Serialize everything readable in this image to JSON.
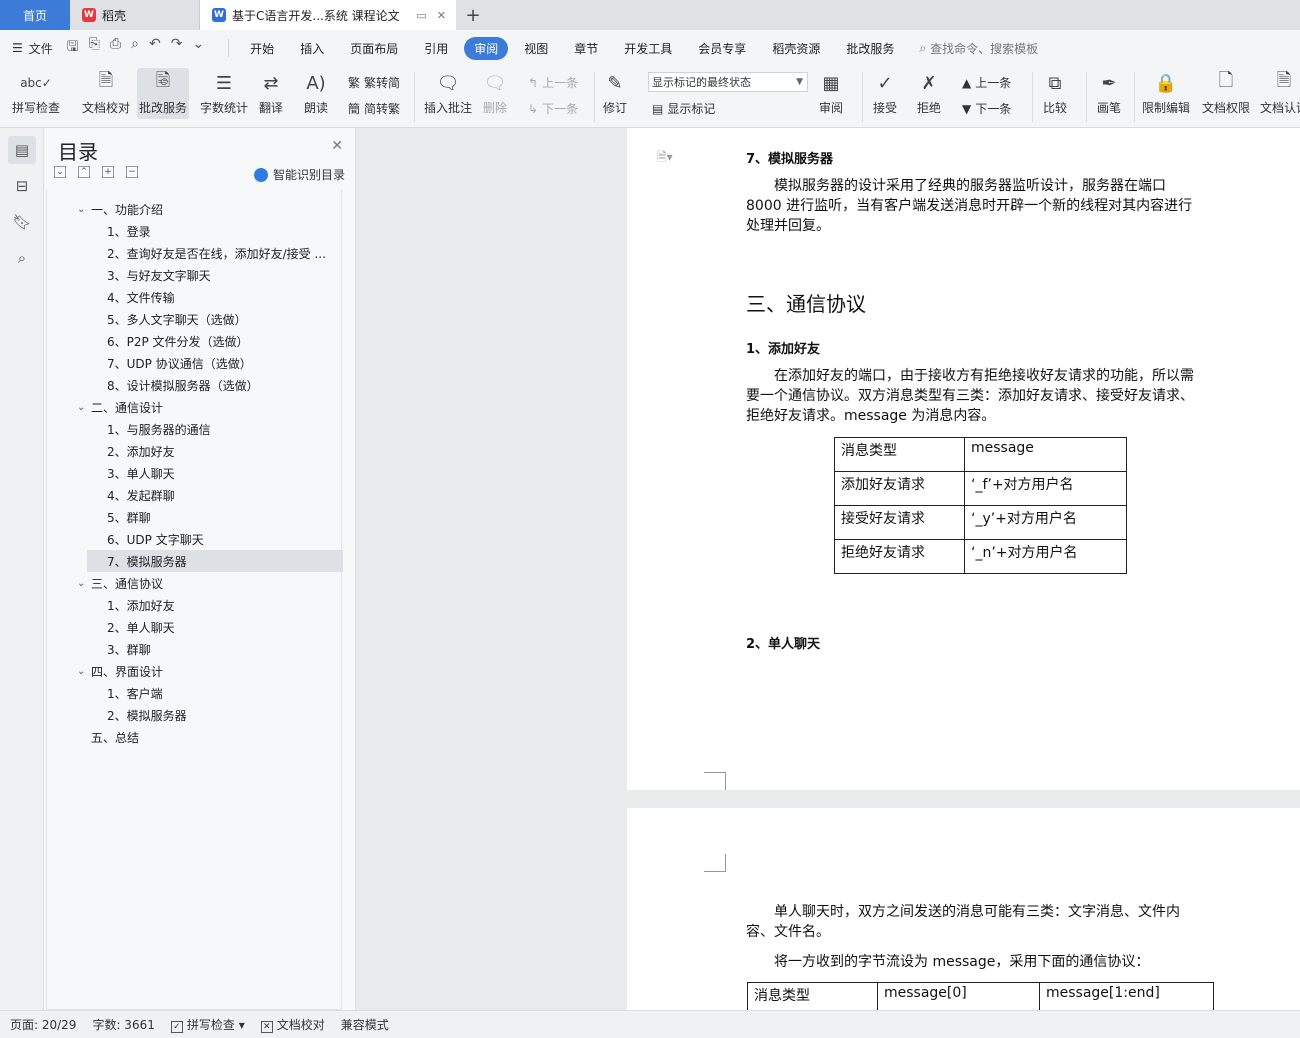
{
  "tabs": {
    "home": "首页",
    "wps": "稻壳",
    "doc": "基于C语言开发...系统 课程论文"
  },
  "menu": {
    "file": "文件",
    "tabs": [
      "开始",
      "插入",
      "页面布局",
      "引用",
      "审阅",
      "视图",
      "章节",
      "开发工具",
      "会员专享",
      "稻壳资源",
      "批改服务"
    ],
    "active_tab": "审阅",
    "search_placeholder": "查找命令、搜索模板"
  },
  "ribbon": {
    "spell_check": "拼写检查",
    "doc_proof": "文档校对",
    "correction_service": "批改服务",
    "word_count": "字数统计",
    "translate": "翻译",
    "read_aloud": "朗读",
    "trad_to_simp": "繁转简",
    "simp_to_trad": "简转繁",
    "insert_comment": "插入批注",
    "delete": "删除",
    "prev_comment": "上一条",
    "next_comment": "下一条",
    "revise": "修订",
    "markup_select": "显示标记的最终状态",
    "show_markup": "显示标记",
    "review": "审阅",
    "accept": "接受",
    "reject": "拒绝",
    "prev_change": "上一条",
    "next_change": "下一条",
    "compare": "比较",
    "pen": "画笔",
    "restrict_edit": "限制编辑",
    "doc_permission": "文档权限",
    "doc_cert": "文档认证"
  },
  "toc": {
    "title": "目录",
    "smart_label": "智能识别目录",
    "items": [
      {
        "level": 1,
        "text": "一、功能介绍",
        "chev": true
      },
      {
        "level": 2,
        "text": "1、登录"
      },
      {
        "level": 2,
        "text": "2、查询好友是否在线，添加好友/接受 ..."
      },
      {
        "level": 2,
        "text": "3、与好友文字聊天"
      },
      {
        "level": 2,
        "text": "4、文件传输"
      },
      {
        "level": 2,
        "text": "5、多人文字聊天（选做）"
      },
      {
        "level": 2,
        "text": "6、P2P 文件分发（选做）"
      },
      {
        "level": 2,
        "text": "7、UDP 协议通信（选做）"
      },
      {
        "level": 2,
        "text": "8、设计模拟服务器（选做）"
      },
      {
        "level": 1,
        "text": "二、通信设计",
        "chev": true
      },
      {
        "level": 2,
        "text": "1、与服务器的通信"
      },
      {
        "level": 2,
        "text": "2、添加好友"
      },
      {
        "level": 2,
        "text": "3、单人聊天"
      },
      {
        "level": 2,
        "text": "4、发起群聊"
      },
      {
        "level": 2,
        "text": "5、群聊"
      },
      {
        "level": 2,
        "text": "6、UDP 文字聊天"
      },
      {
        "level": 2,
        "text": "7、模拟服务器",
        "selected": true
      },
      {
        "level": 1,
        "text": "三、通信协议",
        "chev": true
      },
      {
        "level": 2,
        "text": "1、添加好友"
      },
      {
        "level": 2,
        "text": "2、单人聊天"
      },
      {
        "level": 2,
        "text": "3、群聊"
      },
      {
        "level": 1,
        "text": "四、界面设计",
        "chev": true
      },
      {
        "level": 2,
        "text": "1、客户端"
      },
      {
        "level": 2,
        "text": "2、模拟服务器"
      },
      {
        "level": 1,
        "text": "五、总结",
        "chev": false
      }
    ]
  },
  "document": {
    "h_sim_server": "7、模拟服务器",
    "p_sim_server": "模拟服务器的设计采用了经典的服务器监听设计，服务器在端口 8000 进行监听，当有客户端发送消息时开辟一个新的线程对其内容进行处理并回复。",
    "h_protocol": "三、通信协议",
    "h_add_friend": "1、添加好友",
    "p_add_friend": "在添加好友的端口，由于接收方有拒绝接收好友请求的功能，所以需要一个通信协议。双方消息类型有三类：添加好友请求、接受好友请求、拒绝好友请求。message 为消息内容。",
    "table1": {
      "header": [
        "消息类型",
        "message"
      ],
      "rows": [
        [
          "添加好友请求",
          "‘_f’+对方用户名"
        ],
        [
          "接受好友请求",
          "‘_y’+对方用户名"
        ],
        [
          "拒绝好友请求",
          "‘_n’+对方用户名"
        ]
      ]
    },
    "h_single_chat": "2、单人聊天",
    "p_single_chat": "单人聊天时，双方之间发送的消息可能有三类：文字消息、文件内容、文件名。",
    "p_protocol_msg": "将一方收到的字节流设为 message，采用下面的通信协议：",
    "table2": {
      "header": [
        "消息类型",
        "message[0]",
        "message[1:end]"
      ]
    }
  },
  "status": {
    "page": "页面: 20/29",
    "words": "字数: 3661",
    "spell": "拼写检查",
    "proof": "文档校对",
    "compat": "兼容模式"
  }
}
